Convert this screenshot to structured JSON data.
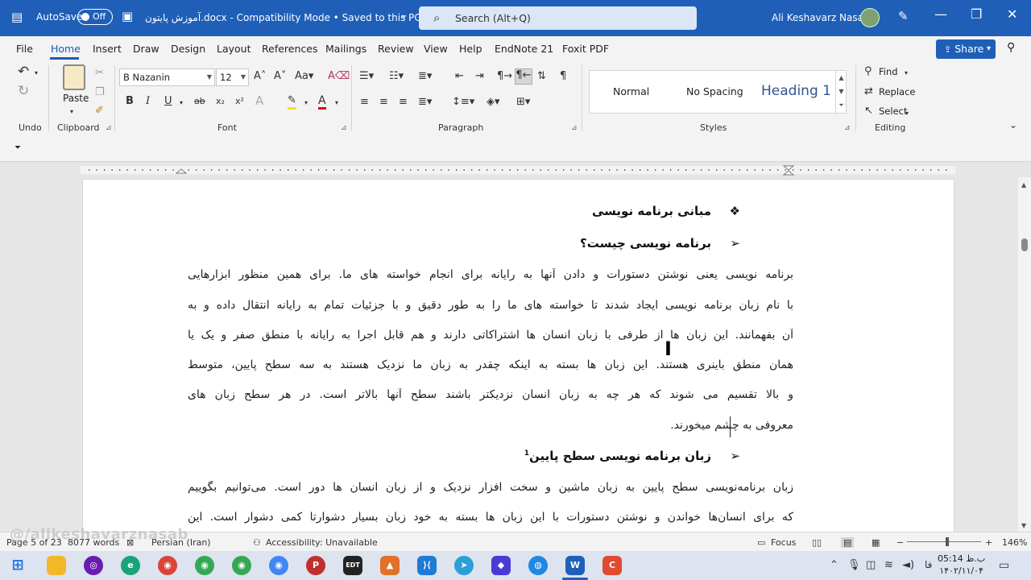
{
  "titlebar": {
    "autosave_label": "AutoSave",
    "autosave_state": "Off",
    "doc_title": "آموزش پایتون.docx  -  Compatibility Mode • Saved to this PC",
    "search_placeholder": "Search (Alt+Q)",
    "user_name": "Ali Keshavarz Nasab"
  },
  "menu": {
    "items": [
      "File",
      "Home",
      "Insert",
      "Draw",
      "Design",
      "Layout",
      "References",
      "Mailings",
      "Review",
      "View",
      "Help",
      "EndNote 21",
      "Foxit PDF"
    ],
    "active": "Home",
    "share_label": "Share"
  },
  "ribbon": {
    "undo_group": "Undo",
    "clipboard": {
      "paste_label": "Paste",
      "group": "Clipboard"
    },
    "font": {
      "name": "B Nazanin",
      "size": "12",
      "group": "Font"
    },
    "paragraph": {
      "group": "Paragraph"
    },
    "styles": {
      "items": [
        "Normal",
        "No Spacing",
        "Heading 1"
      ],
      "group": "Styles"
    },
    "editing": {
      "find": "Find",
      "replace": "Replace",
      "select": "Select",
      "group": "Editing"
    }
  },
  "document": {
    "heading1": "مبانی برنامه نویسی",
    "heading2": "برنامه نویسی چیست؟",
    "para1": [
      "برنامه نویسی یعنی نوشتن دستورات و دادن آنها به رایانه برای انجام خواسته های ما. برای همین منظور ابزارهایی",
      "با نام زبان برنامه نویسی ایجاد شدند تا خواسته های ما را به طور دقیق و با جزئیات تمام به رایانه انتقال داده و به",
      "آن بفهمانند. این زبان ها از طرفی با زبان انسان ها اشتراکاتی دارند و هم قابل اجرا به رایانه با منطق صفر و یک یا",
      "همان منطق باینری هستند. این زبان ها بسته به اینکه چقدر به زبان ما نزدیک هستند به سه سطح پایین، متوسط",
      "و بالا تقسیم می شوند که هر چه به زبان انسان نزدیکتر باشند سطح آنها بالاتر است. در هر سطح زبان های",
      "معروفی به چشم میخورند."
    ],
    "heading3": "زبان برنامه نویسی سطح پایین",
    "heading3_note": "1",
    "para2": [
      "زبان برنامه‌نویسی سطح پایین به زبان ماشین و سخت افزار نزدیک و از زبان انسان ها دور است. می‌توانیم بگوییم",
      "که برای انسان‌ها خواندن و نوشتن دستورات با این زبان ها بسته به خود زبان بسیار دشوارتا کمی دشوار است. این"
    ]
  },
  "status": {
    "page": "Page 5 of 23",
    "words": "8077 words",
    "language": "Persian (Iran)",
    "accessibility": "Accessibility: Unavailable",
    "focus": "Focus",
    "zoom": "146%"
  },
  "watermark": "@/alikeshavarznasab",
  "clock": {
    "time": "05:14 ب.ظ",
    "date": "۱۴۰۲/۱۱/۰۴"
  },
  "tray": {
    "lang": "فا"
  }
}
